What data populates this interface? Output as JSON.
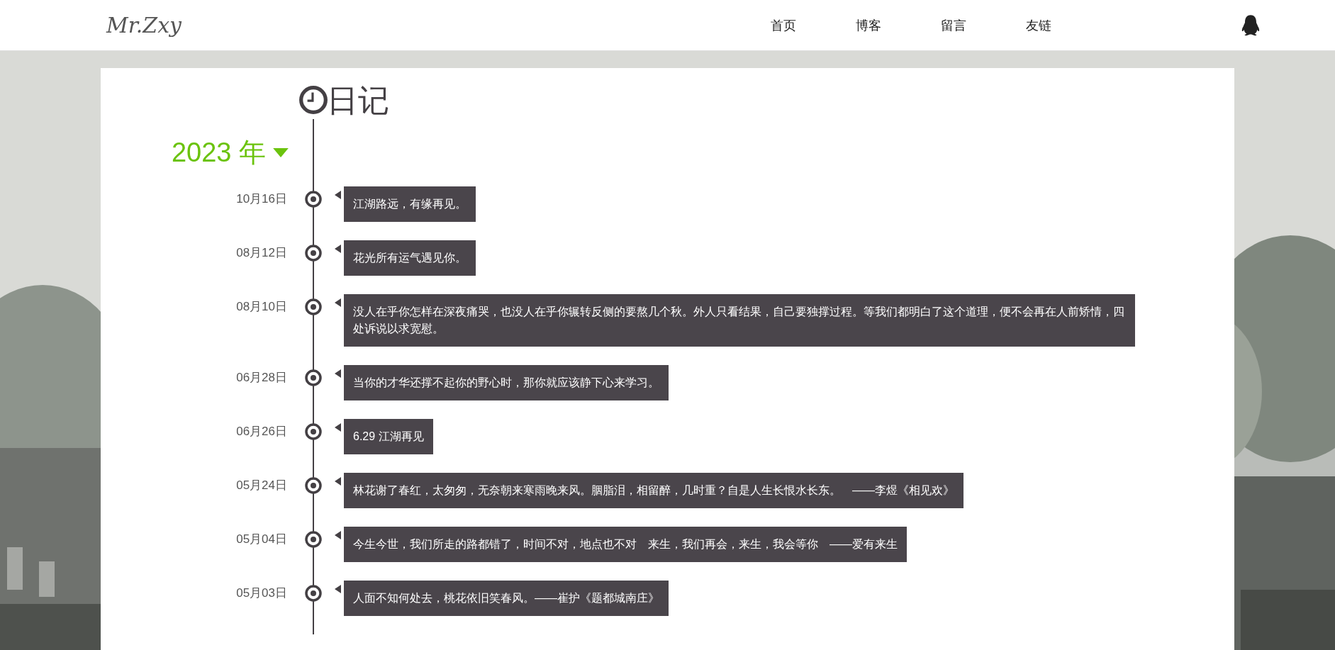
{
  "header": {
    "logo": "Mr.Zxy",
    "nav": [
      "首页",
      "博客",
      "留言",
      "友链"
    ]
  },
  "page": {
    "title": "日记",
    "year": "2023 年",
    "entries": [
      {
        "date": "10月16日",
        "text": "江湖路远，有缘再见。"
      },
      {
        "date": "08月12日",
        "text": "花光所有运气遇见你。"
      },
      {
        "date": "08月10日",
        "text": "没人在乎你怎样在深夜痛哭，也没人在乎你辗转反侧的要熬几个秋。外人只看结果，自己要独撑过程。等我们都明白了这个道理，便不会再在人前矫情，四处诉说以求宽慰。"
      },
      {
        "date": "06月28日",
        "text": "当你的才华还撑不起你的野心时，那你就应该静下心来学习。"
      },
      {
        "date": "06月26日",
        "text": "6.29 江湖再见"
      },
      {
        "date": "05月24日",
        "text": "林花谢了春红，太匆匆，无奈朝来寒雨晚来风。胭脂泪，相留醉，几时重？自是人生长恨水长东。　——李煜《相见欢》"
      },
      {
        "date": "05月04日",
        "text": "今生今世，我们所走的路都错了，时间不对，地点也不对　来生，我们再会，来生，我会等你　——爱有来生"
      },
      {
        "date": "05月03日",
        "text": "人面不知何处去，桃花依旧笑春风。——崔护《题都城南庄》"
      }
    ]
  }
}
